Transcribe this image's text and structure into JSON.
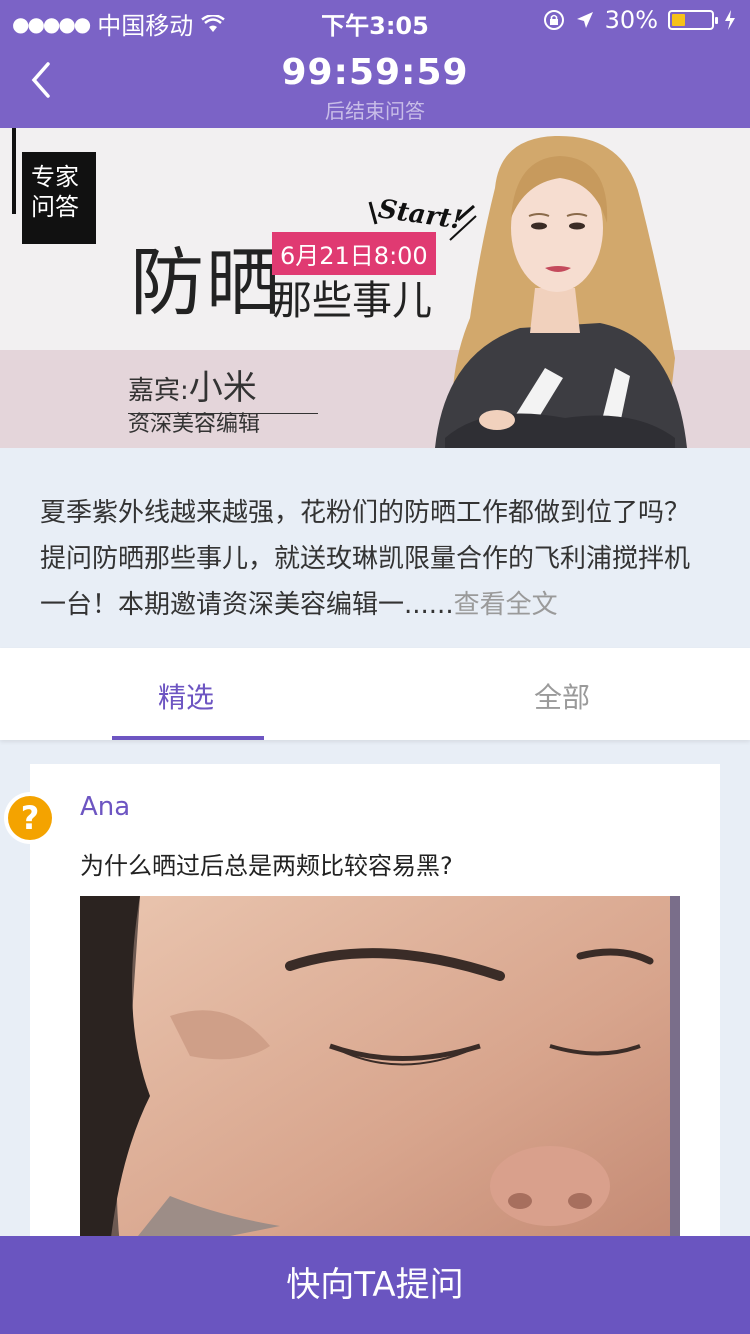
{
  "status_bar": {
    "signal_dots": "●●●●●",
    "carrier": "中国移动",
    "time": "下午3:05",
    "battery_percent": "30%",
    "battery_level": 0.3
  },
  "nav": {
    "countdown": "99:59:59",
    "countdown_caption": "后结束问答"
  },
  "banner": {
    "tag_line1": "专家",
    "tag_line2": "问答",
    "title": "防晒",
    "date": "6月21日8:00",
    "subtitle": "那些事儿",
    "start_text": "Start!",
    "guest_label": "嘉宾:",
    "guest_name": "小米",
    "guest_role": "资深美容编辑"
  },
  "intro": {
    "text": "夏季紫外线越来越强，花粉们的防晒工作都做到位了吗？提问防晒那些事儿，就送玫琳凯限量合作的飞利浦搅拌机一台！本期邀请资深美容编辑一......",
    "more": "查看全文"
  },
  "tabs": [
    {
      "label": "精选",
      "active": true
    },
    {
      "label": "全部",
      "active": false
    }
  ],
  "question_card": {
    "badge": "?",
    "user": "Ana",
    "question": "为什么晒过后总是两颊比较容易黑?"
  },
  "ask_button": "快向TA提问",
  "colors": {
    "accent": "#7b63c6",
    "badge_orange": "#f4a300",
    "date_pink": "#e03a72"
  }
}
